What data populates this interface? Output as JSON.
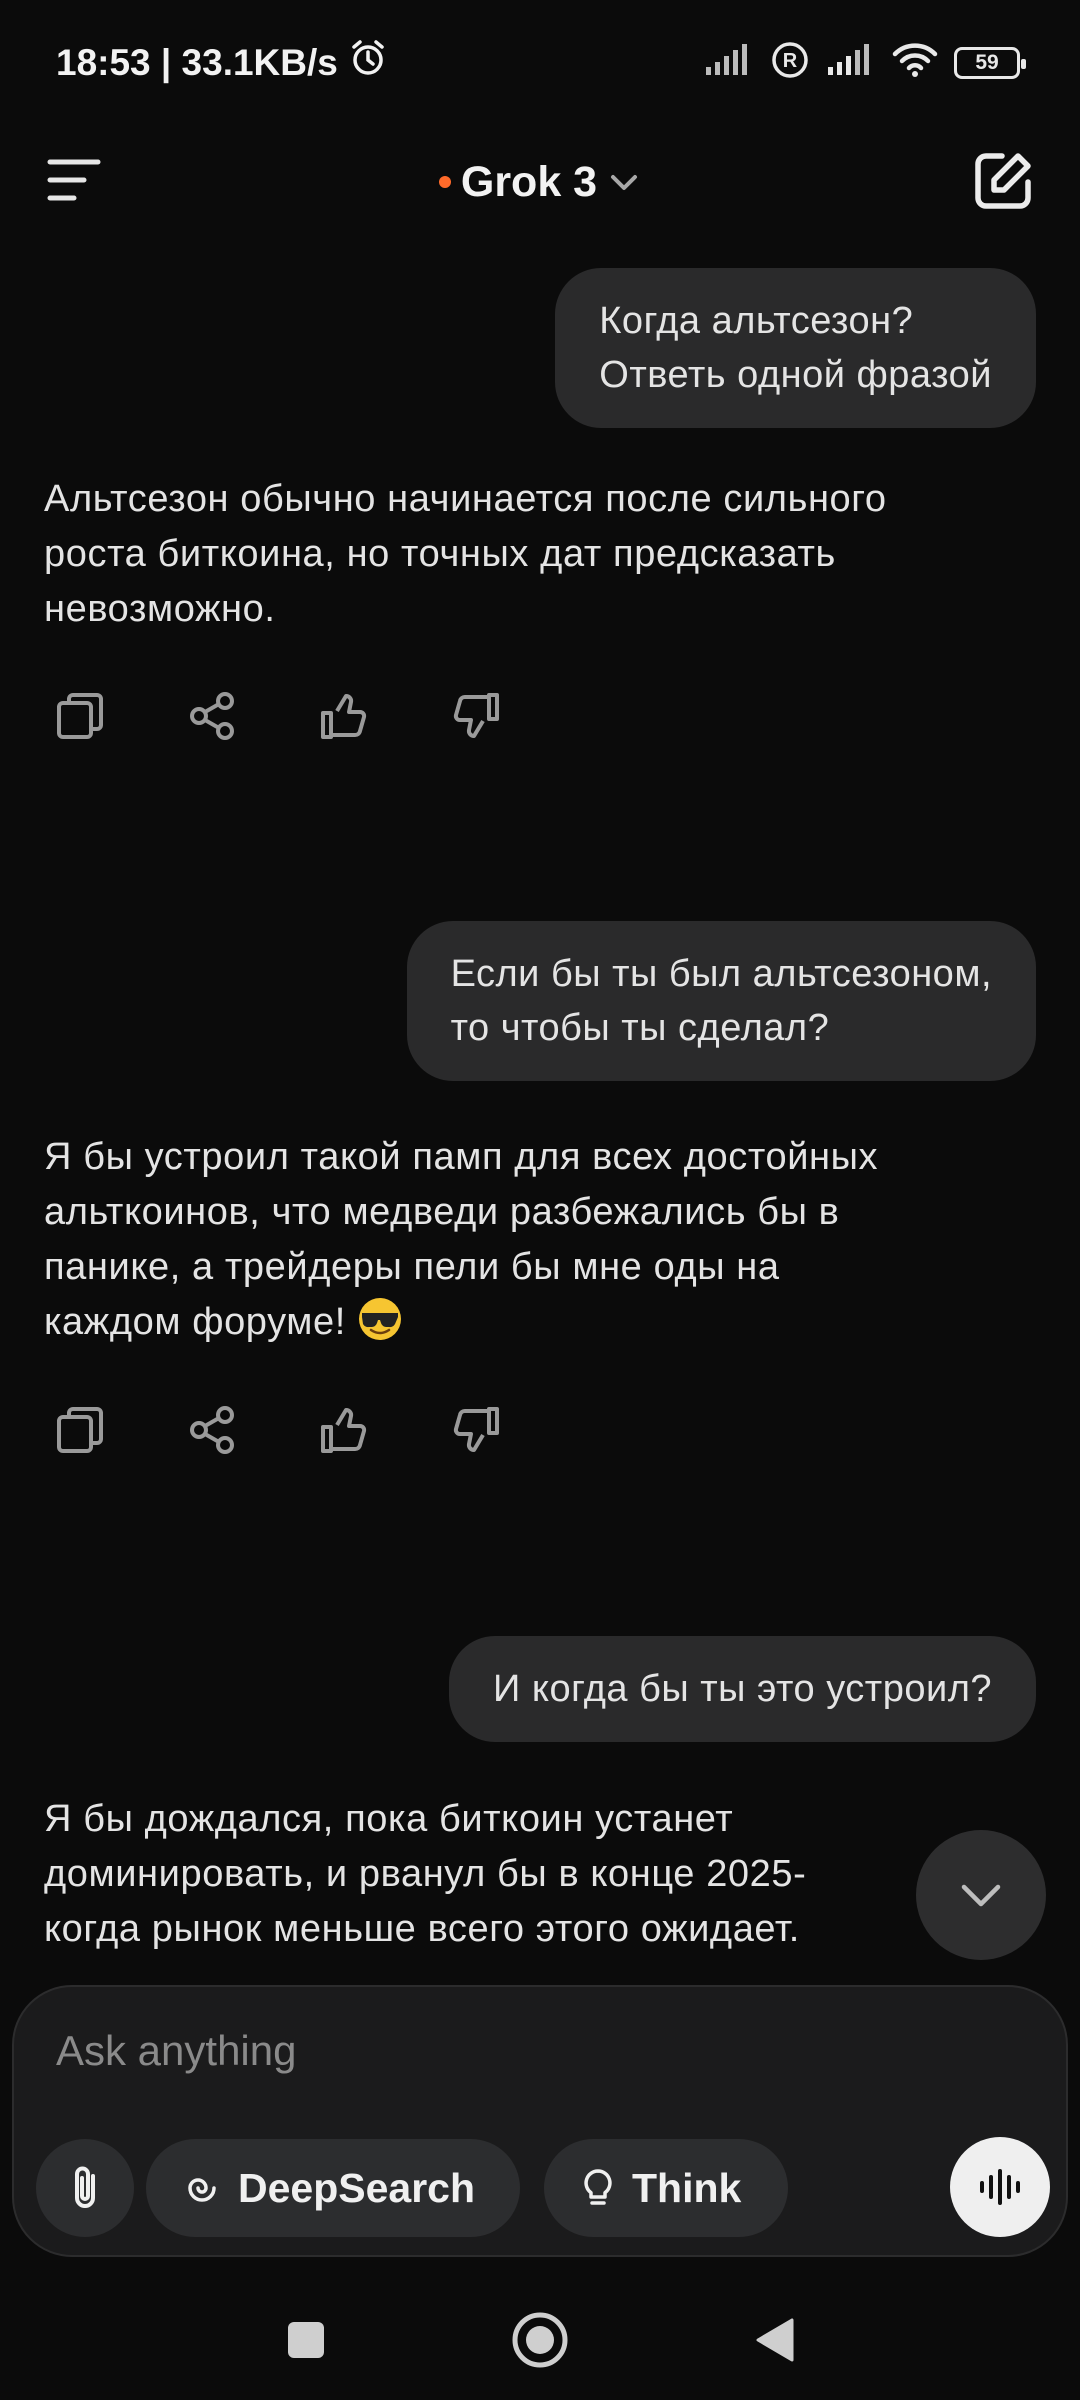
{
  "status_bar": {
    "time_speed": "18:53 | 33.1KB/s",
    "battery": "59"
  },
  "header": {
    "model_name": "Grok 3"
  },
  "messages": [
    {
      "role": "user",
      "lines": [
        "Когда альтсезон?",
        "Ответь одной фразой"
      ]
    },
    {
      "role": "assistant",
      "lines": [
        "Альтсезон обычно начинается после сильного",
        "роста биткоина, но точных дат предсказать",
        "невозможно."
      ]
    },
    {
      "role": "user",
      "lines": [
        "Если бы ты был альтсезоном,",
        "то чтобы ты сделал?"
      ]
    },
    {
      "role": "assistant",
      "lines": [
        "Я бы устроил такой памп для всех достойных",
        "альткоинов, что медведи разбежались бы в",
        "панике, а трейдеры пели бы мне оды на",
        "каждом форуме!"
      ]
    },
    {
      "role": "user",
      "lines": [
        "И когда бы ты это устроил?"
      ]
    },
    {
      "role": "assistant",
      "lines": [
        "Я бы дождался, пока биткоин устанет",
        "доминировать, и рванул бы в конце 2025-",
        "когда рынок меньше всего этого ожидает."
      ]
    }
  ],
  "composer": {
    "placeholder": "Ask anything",
    "deepsearch_label": "DeepSearch",
    "think_label": "Think"
  },
  "colors": {
    "background": "#0b0b0b",
    "user_bubble": "#2a2a2b",
    "model_dot": "#ff6a2a",
    "chip": "#2c2d2f"
  },
  "icons": [
    "menu-icon",
    "chevron-down-icon",
    "edit-icon",
    "copy-icon",
    "share-icon",
    "thumbs-up-icon",
    "thumbs-down-icon",
    "paperclip-icon",
    "deepsearch-icon",
    "lightbulb-icon",
    "voice-icon",
    "square-icon",
    "circle-icon",
    "triangle-back-icon",
    "sunglasses-emoji"
  ]
}
